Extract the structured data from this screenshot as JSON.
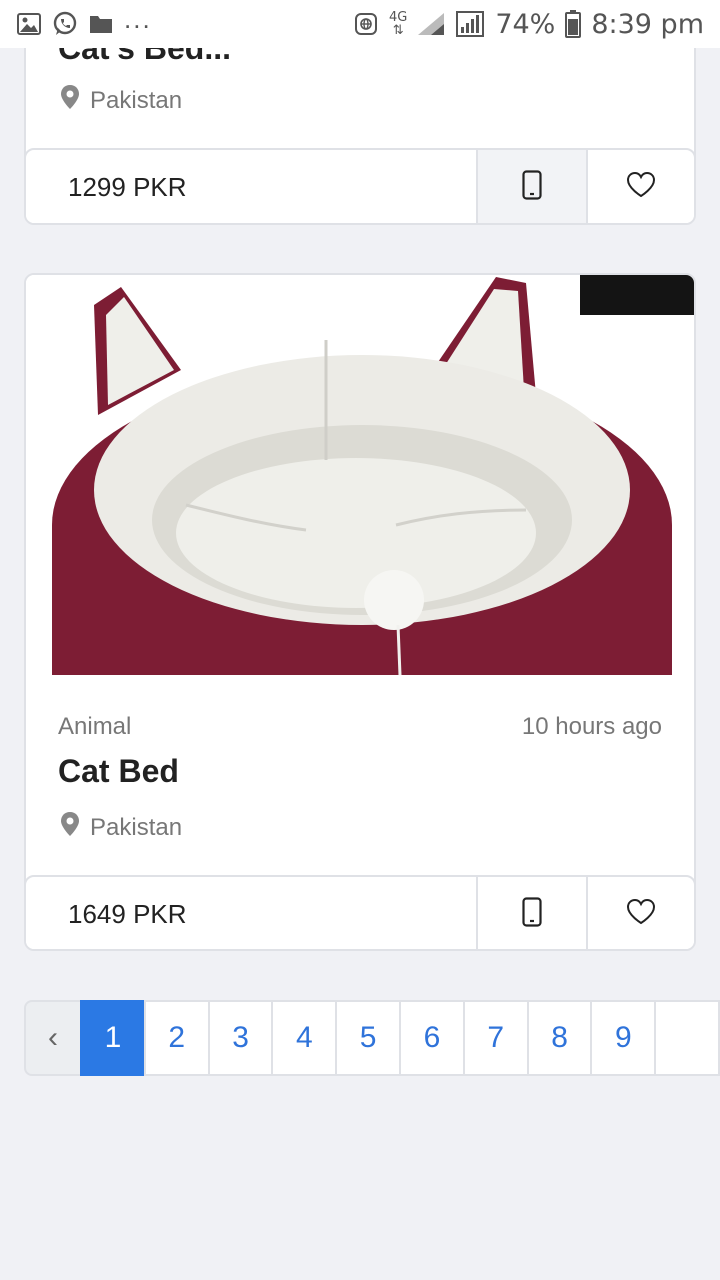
{
  "status_bar": {
    "battery": "74%",
    "time": "8:39 pm",
    "network": "4G",
    "more": "..."
  },
  "listings": [
    {
      "title_partial": "Cat's Bed...",
      "location": "Pakistan",
      "price": "1299 PKR"
    },
    {
      "category": "Animal",
      "time_ago": "10 hours ago",
      "title": "Cat Bed",
      "location": "Pakistan",
      "price": "1649 PKR",
      "image_colors": {
        "outer": "#7d1d34",
        "inner": "#ecebe6"
      }
    }
  ],
  "pagination": {
    "prev": "‹",
    "pages": [
      "1",
      "2",
      "3",
      "4",
      "5",
      "6",
      "7",
      "8",
      "9"
    ],
    "current": "1"
  },
  "colors": {
    "accent": "#2b79e4",
    "page_link": "#2f73da",
    "background": "#f0f1f5"
  }
}
